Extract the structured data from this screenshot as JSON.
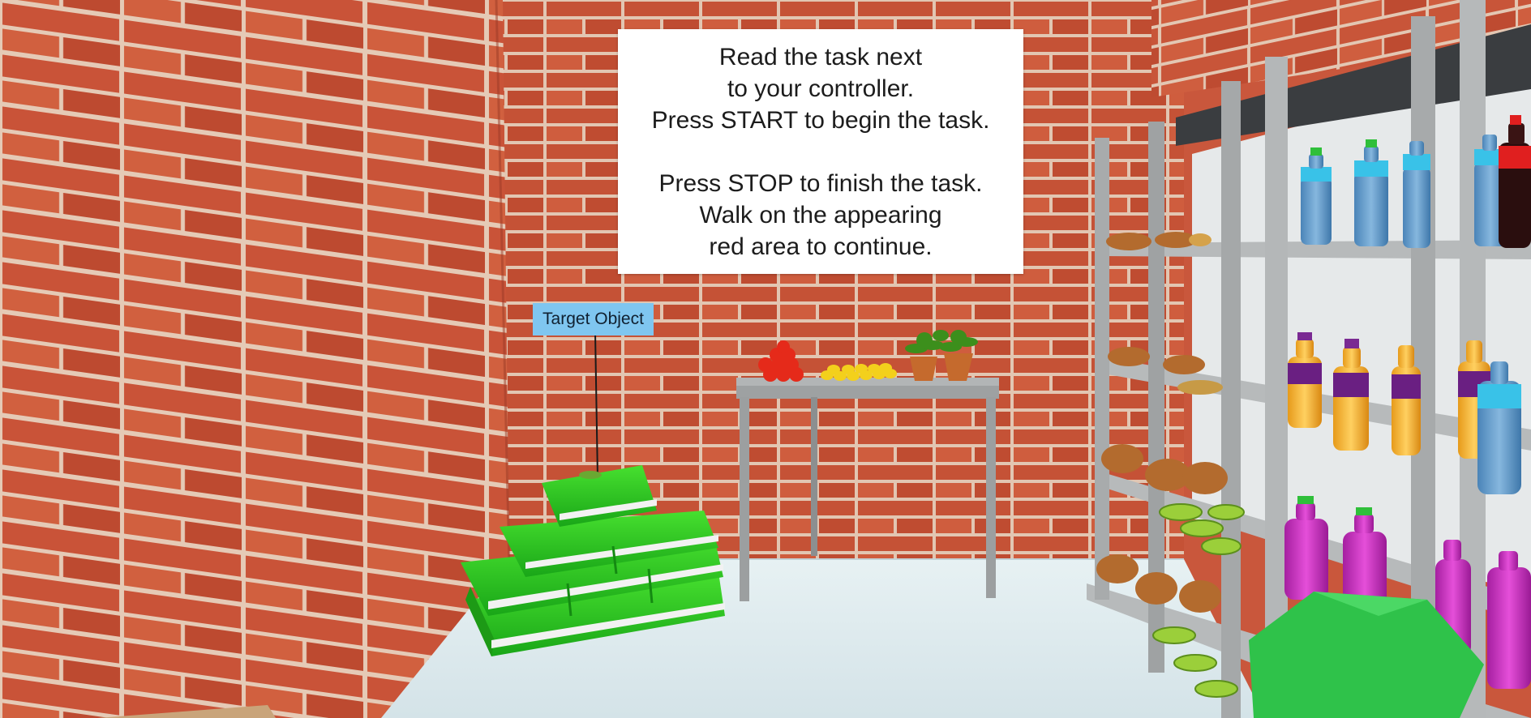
{
  "scene": {
    "instruction_sign": {
      "lines_top": [
        "Read the task next",
        "to your controller.",
        "Press START to begin the task."
      ],
      "lines_bottom": [
        "Press STOP to finish the task.",
        "Walk on the appearing",
        "red area to continue."
      ]
    },
    "target_label": "Target Object",
    "colors": {
      "brick": "#c9573c",
      "mortar": "#e3c9b8",
      "floor": "#dbe8ec",
      "books": "#27c21f",
      "label_bg": "#7fc6f0",
      "shelf": "#a9acad"
    },
    "objects": [
      "brick-walls",
      "green-book-stack",
      "side-table",
      "tomatoes",
      "lemons",
      "potted-plants",
      "grocery-shelf",
      "water-bottles",
      "juice-bottles",
      "pink-bottles",
      "bread-loaves",
      "green-bowls",
      "green-controller-hand"
    ]
  }
}
